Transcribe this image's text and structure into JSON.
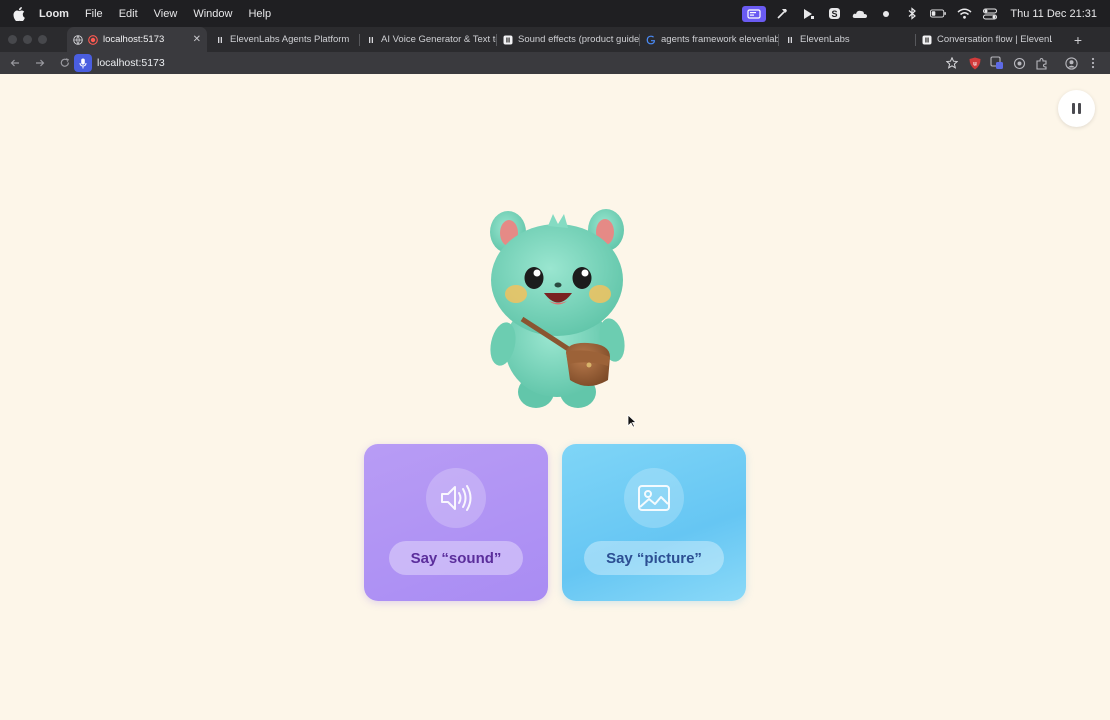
{
  "menubar": {
    "app_name": "Loom",
    "menus": [
      "File",
      "Edit",
      "View",
      "Window",
      "Help"
    ],
    "clock": "Thu 11 Dec  21:31"
  },
  "tabs": [
    {
      "label": "localhost:5173",
      "active": true
    },
    {
      "label": "ElevenLabs Agents Platform",
      "active": false
    },
    {
      "label": "AI Voice Generator & Text to",
      "active": false
    },
    {
      "label": "Sound effects (product guide)",
      "active": false
    },
    {
      "label": "agents framework elevenlabs",
      "active": false
    },
    {
      "label": "ElevenLabs",
      "active": false
    },
    {
      "label": "Conversation flow | ElevenLabs",
      "active": false
    }
  ],
  "address": {
    "url": "localhost:5173"
  },
  "page": {
    "cards": [
      {
        "label": "Say “sound”",
        "icon": "speaker-icon",
        "color": "#b09af4"
      },
      {
        "label": "Say “picture”",
        "icon": "image-icon",
        "color": "#72cdf5"
      }
    ]
  },
  "colors": {
    "page_bg": "#fdf6e9",
    "sound_card": "#b09af4",
    "picture_card": "#72cdf5",
    "mascot_body": "#7dd8bf"
  }
}
